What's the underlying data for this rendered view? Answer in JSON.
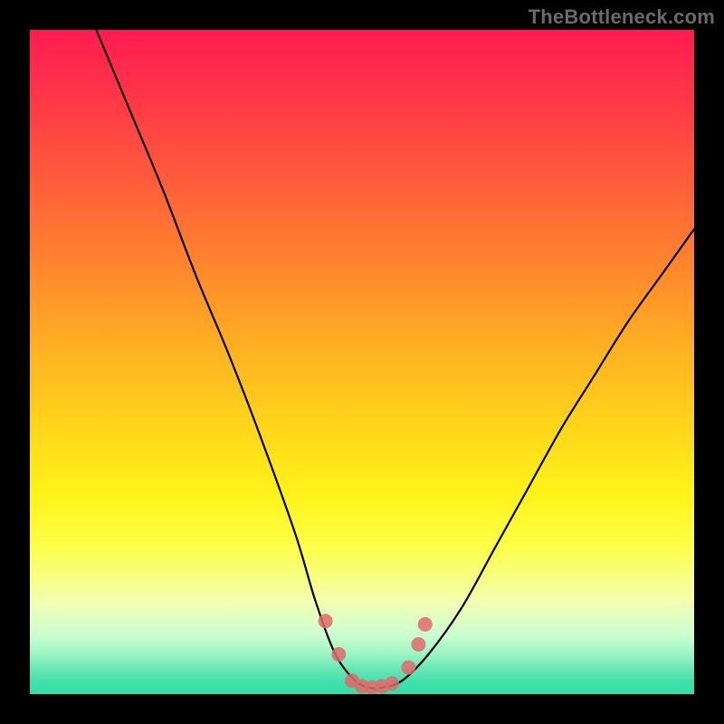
{
  "watermark": "TheBottleneck.com",
  "chart_data": {
    "type": "line",
    "title": "",
    "xlabel": "",
    "ylabel": "",
    "xlim": [
      0,
      100
    ],
    "ylim": [
      0,
      100
    ],
    "series": [
      {
        "name": "bottleneck-curve",
        "x": [
          10,
          15,
          20,
          25,
          30,
          35,
          40,
          43,
          46,
          49,
          51,
          53,
          56,
          60,
          65,
          70,
          75,
          80,
          85,
          90,
          95,
          100
        ],
        "y": [
          100,
          88,
          76,
          63,
          51,
          38,
          24,
          14,
          6,
          2,
          1,
          1,
          2,
          6,
          13,
          22,
          31,
          40,
          48,
          56,
          63,
          70
        ]
      }
    ],
    "markers": {
      "name": "highlight-dots",
      "x": [
        44.5,
        46.5,
        48.5,
        50.0,
        51.5,
        53.0,
        54.5,
        57.0,
        58.5,
        59.5
      ],
      "y": [
        11.0,
        6.0,
        2.0,
        1.2,
        1.0,
        1.2,
        1.6,
        4.0,
        7.5,
        10.5
      ]
    },
    "gradient_stops": [
      {
        "pos": 0.0,
        "color": "#ff1b52"
      },
      {
        "pos": 0.35,
        "color": "#ff842e"
      },
      {
        "pos": 0.7,
        "color": "#fff31a"
      },
      {
        "pos": 0.94,
        "color": "#9bf6c3"
      },
      {
        "pos": 1.0,
        "color": "#2fe0a7"
      }
    ],
    "marker_color": "#e06a6a",
    "curve_color": "#000000"
  }
}
